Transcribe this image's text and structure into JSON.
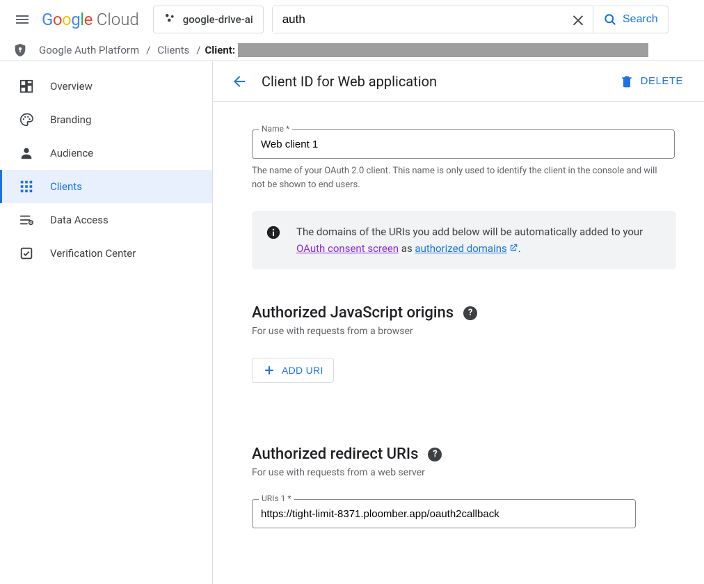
{
  "header": {
    "logo_word1": "Google",
    "logo_word2": "Cloud",
    "project": "google-drive-ai",
    "search_value": "auth",
    "search_button": "Search"
  },
  "breadcrumb": {
    "root": "Google Auth Platform",
    "clients": "Clients",
    "client_label": "Client:"
  },
  "sidebar": {
    "items": [
      {
        "label": "Overview"
      },
      {
        "label": "Branding"
      },
      {
        "label": "Audience"
      },
      {
        "label": "Clients"
      },
      {
        "label": "Data Access"
      },
      {
        "label": "Verification Center"
      }
    ]
  },
  "page": {
    "title": "Client ID for Web application",
    "delete": "DELETE"
  },
  "form": {
    "name_label": "Name *",
    "name_value": "Web client 1",
    "name_help": "The name of your OAuth 2.0 client. This name is only used to identify the client in the console and will not be shown to end users.",
    "banner_pre": "The domains of the URIs you add below will be automatically added to your ",
    "banner_link1": "OAuth consent screen",
    "banner_mid": " as ",
    "banner_link2": "authorized domains",
    "banner_post": ".",
    "js_title": "Authorized JavaScript origins",
    "js_sub": "For use with requests from a browser",
    "add_uri": "ADD URI",
    "redir_title": "Authorized redirect URIs",
    "redir_sub": "For use with requests from a web server",
    "uri1_label": "URIs 1 *",
    "uri1_value": "https://tight-limit-8371.ploomber.app/oauth2callback"
  }
}
